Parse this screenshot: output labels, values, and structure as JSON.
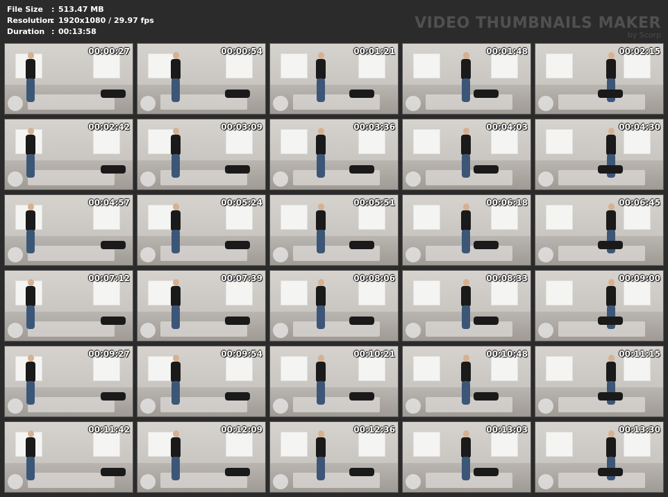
{
  "info": {
    "rows": [
      {
        "key": "File Size",
        "value": "513.47 MB"
      },
      {
        "key": "Resolution",
        "value": "1920x1080 / 29.97 fps"
      },
      {
        "key": "Duration",
        "value": "00:13:58"
      }
    ],
    "separator": ":"
  },
  "brand": {
    "title": "VIDEO THUMBNAILS MAKER",
    "subtitle": "by Scorp"
  },
  "thumbnails": [
    {
      "time": "00:00:27"
    },
    {
      "time": "00:00:54"
    },
    {
      "time": "00:01:21"
    },
    {
      "time": "00:01:48"
    },
    {
      "time": "00:02:15"
    },
    {
      "time": "00:02:42"
    },
    {
      "time": "00:03:09"
    },
    {
      "time": "00:03:36"
    },
    {
      "time": "00:04:03"
    },
    {
      "time": "00:04:30"
    },
    {
      "time": "00:04:57"
    },
    {
      "time": "00:05:24"
    },
    {
      "time": "00:05:51"
    },
    {
      "time": "00:06:18"
    },
    {
      "time": "00:06:45"
    },
    {
      "time": "00:07:12"
    },
    {
      "time": "00:07:39"
    },
    {
      "time": "00:08:06"
    },
    {
      "time": "00:08:33"
    },
    {
      "time": "00:09:00"
    },
    {
      "time": "00:09:27"
    },
    {
      "time": "00:09:54"
    },
    {
      "time": "00:10:21"
    },
    {
      "time": "00:10:48"
    },
    {
      "time": "00:11:15"
    },
    {
      "time": "00:11:42"
    },
    {
      "time": "00:12:09"
    },
    {
      "time": "00:12:36"
    },
    {
      "time": "00:13:03"
    },
    {
      "time": "00:13:30"
    }
  ]
}
